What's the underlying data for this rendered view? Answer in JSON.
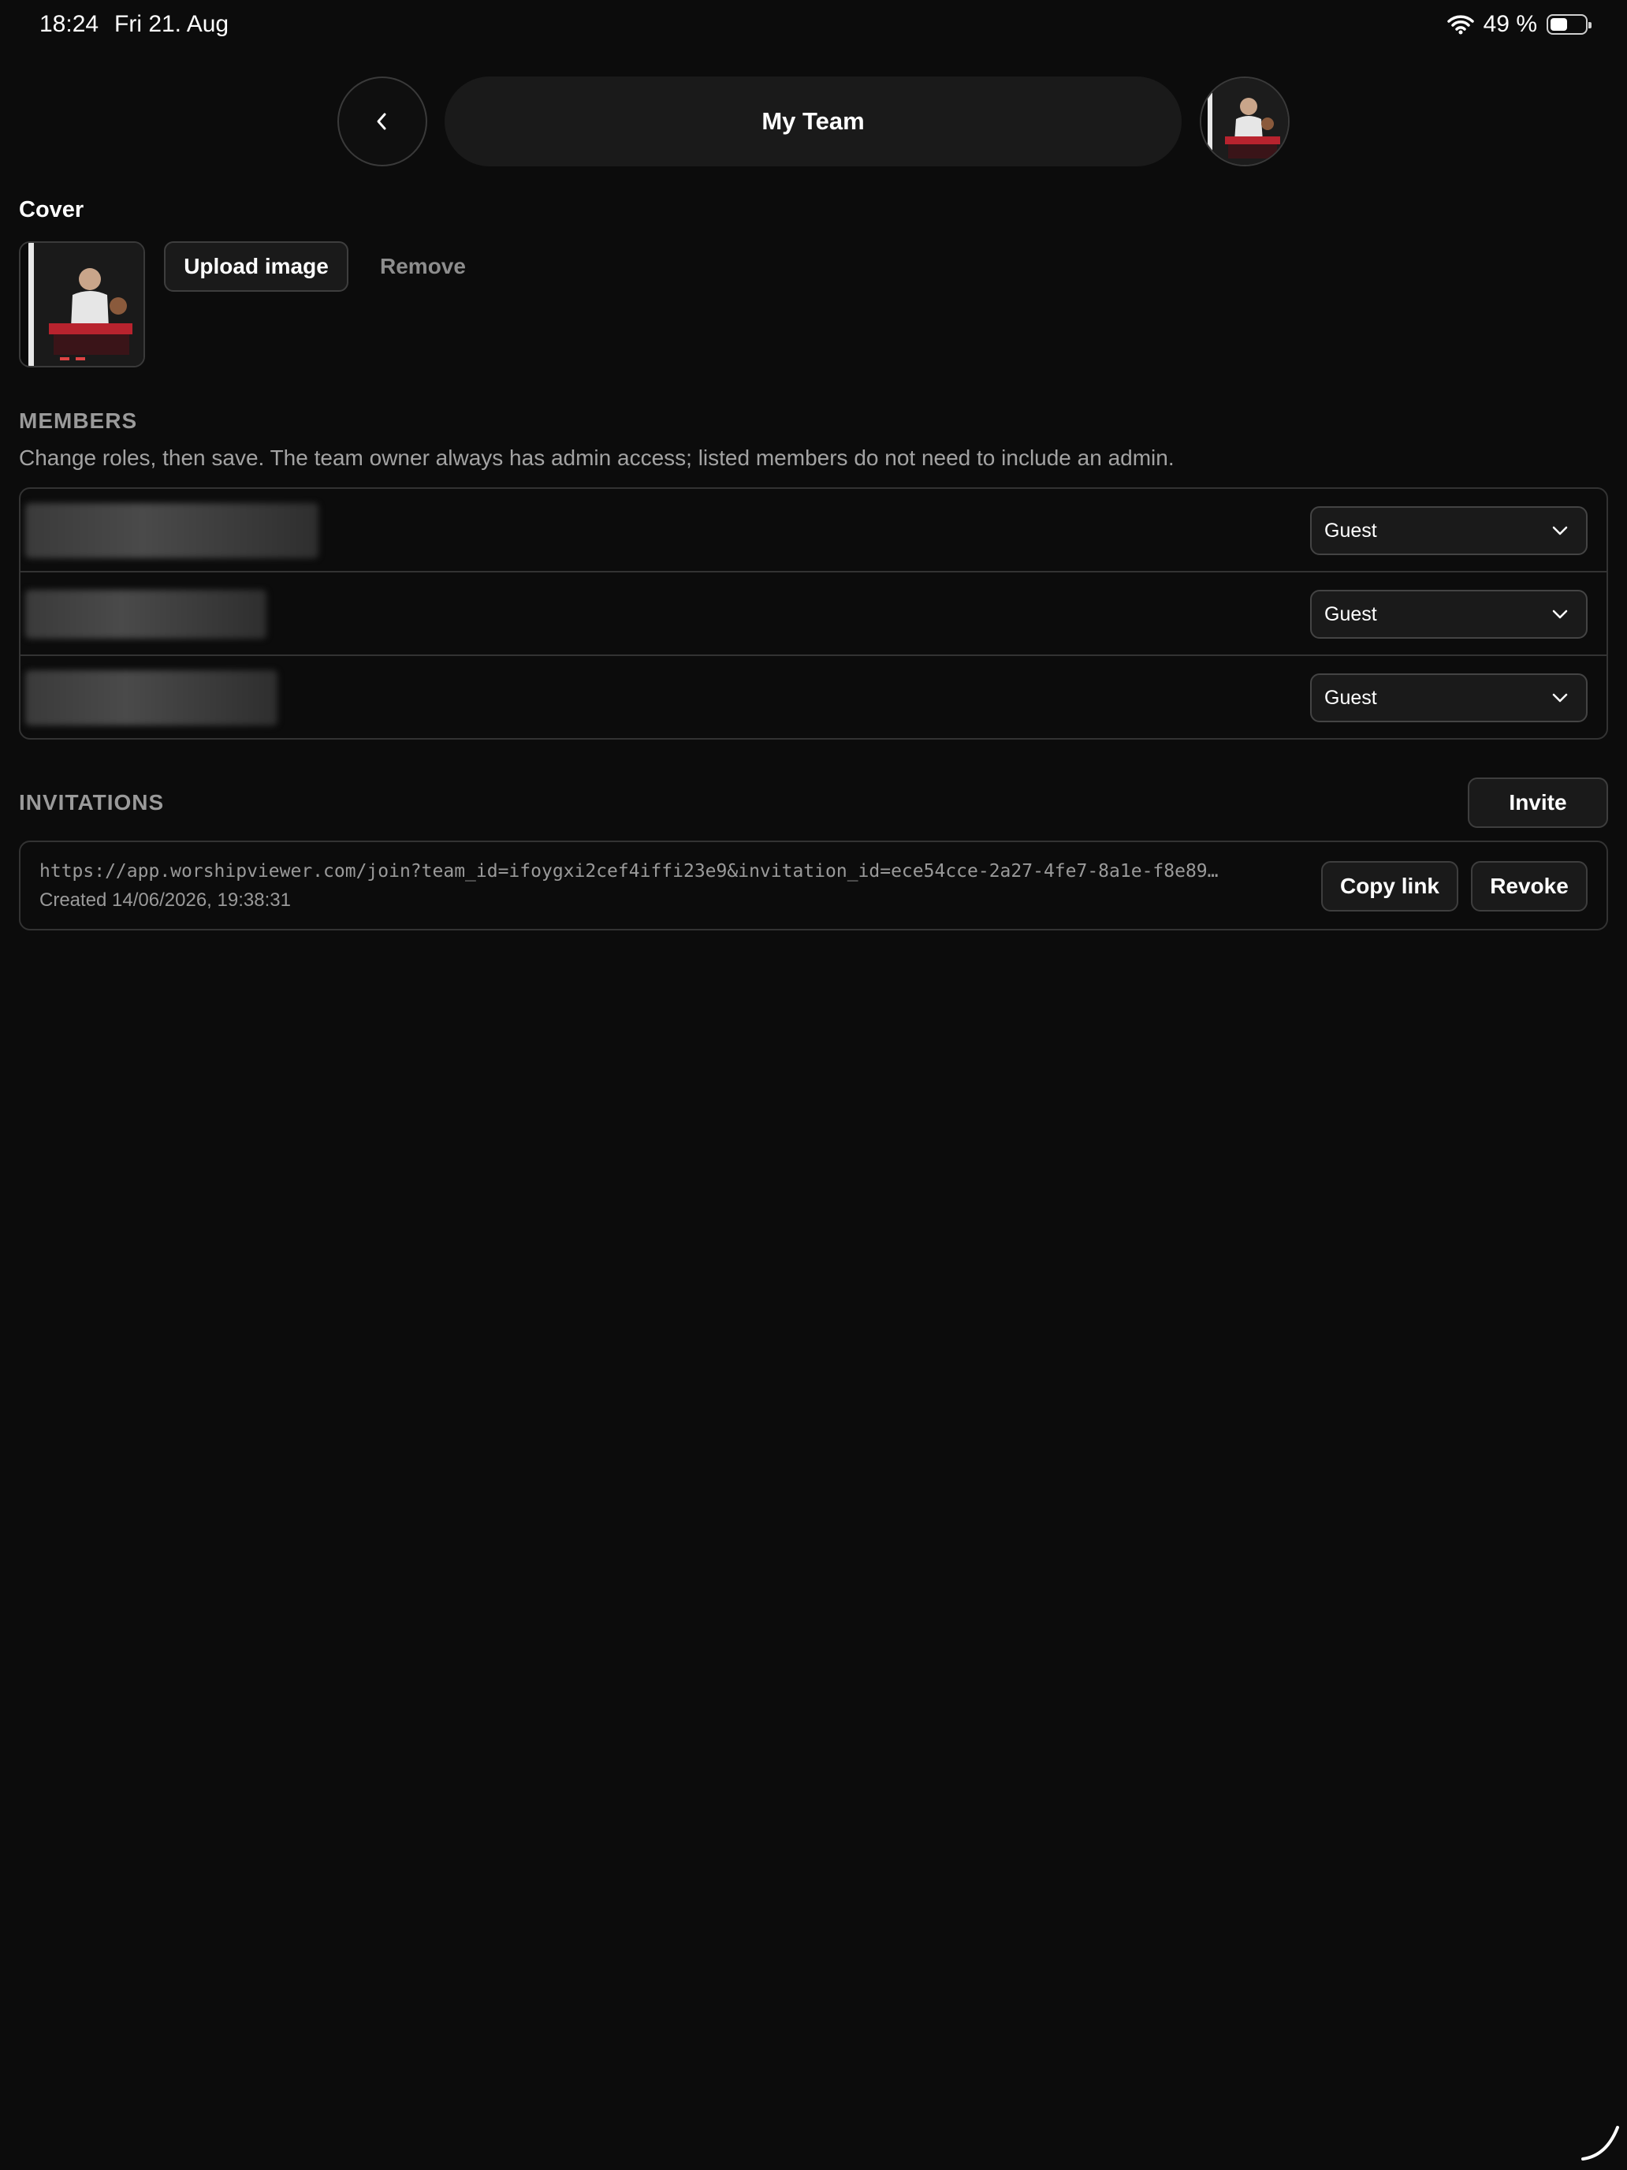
{
  "status_bar": {
    "time": "18:24",
    "date": "Fri 21. Aug",
    "battery_text": "49 %",
    "battery_level": 0.49,
    "icons": [
      "wifi-icon",
      "battery-icon"
    ]
  },
  "header": {
    "title": "My Team",
    "back_icon": "chevron-left-icon"
  },
  "cover": {
    "label": "Cover",
    "upload_label": "Upload image",
    "remove_label": "Remove"
  },
  "members": {
    "heading": "MEMBERS",
    "description": "Change roles, then save. The team owner always has admin access; listed members do not need to include an admin.",
    "rows": [
      {
        "role": "Guest"
      },
      {
        "role": "Guest"
      },
      {
        "role": "Guest"
      }
    ]
  },
  "invitations": {
    "heading": "INVITATIONS",
    "invite_label": "Invite",
    "items": [
      {
        "url": "https://app.worshipviewer.com/join?team_id=ifoygxi2cef4iffi23e9&invitation_id=ece54cce-2a27-4fe7-8a1e-f8e89…",
        "created": "Created 14/06/2026, 19:38:31",
        "copy_label": "Copy link",
        "revoke_label": "Revoke"
      }
    ]
  },
  "colors": {
    "background": "#0c0c0c",
    "surface": "#1a1a1a",
    "border": "#333333",
    "muted_text": "#9a9a9a"
  }
}
